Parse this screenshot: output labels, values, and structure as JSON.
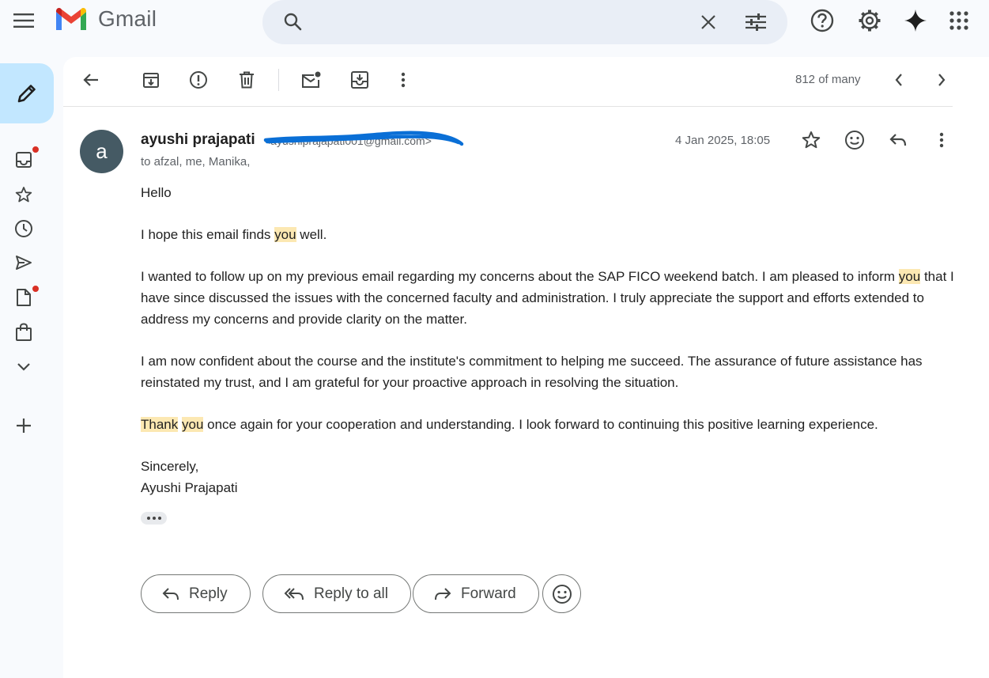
{
  "app": {
    "name": "Gmail"
  },
  "search": {
    "placeholder": ""
  },
  "toolbar": {
    "counter": "812 of many"
  },
  "email": {
    "sender_initial": "a",
    "sender_name": "ayushi prajapati",
    "sender_email": "<ayushiprajapati001@gmail.com>",
    "recipients": "to afzal, me, Manika,",
    "date": "4 Jan 2025, 18:05",
    "body": {
      "greeting": "Hello",
      "p1_before": "I hope this email finds ",
      "p1_hl": "you",
      "p1_after": " well.",
      "p2_before": "I wanted to follow up on my previous email regarding my concerns about the SAP FICO weekend batch. I am pleased to inform ",
      "p2_hl": "you",
      "p2_after": " that I have since discussed the issues with the concerned faculty and administration. I truly appreciate the support and efforts extended to address my concerns and provide clarity on the matter.",
      "p3": "I am now confident about the course and the institute's commitment to helping me succeed. The assurance of future assistance has reinstated my trust, and I am grateful for your proactive approach in resolving the situation.",
      "p4_hl1": "Thank",
      "p4_hl2": "you",
      "p4_after": " once again for your cooperation and understanding. I look forward to continuing this positive learning experience.",
      "closing": "Sincerely,",
      "signature": "Ayushi Prajapati"
    }
  },
  "actions": {
    "reply": "Reply",
    "reply_all": "Reply to all",
    "forward": "Forward"
  },
  "colors": {
    "highlight": "#fce8b2",
    "compose_bg": "#c2e7ff",
    "avatar_bg": "#455a64",
    "notification_dot": "#d93025",
    "redaction_scribble": "#0a6fd6"
  }
}
